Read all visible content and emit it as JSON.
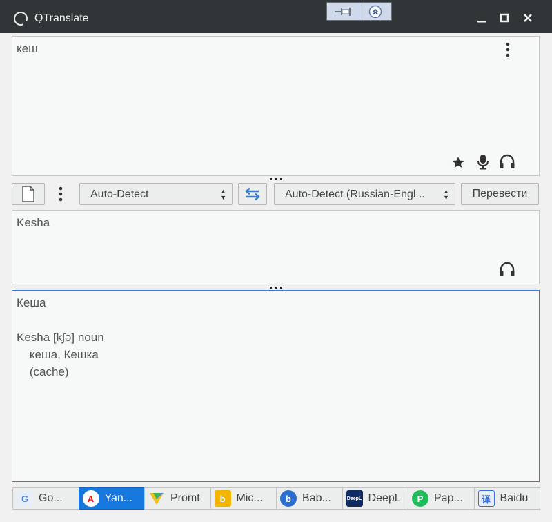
{
  "window": {
    "title": "QTranslate"
  },
  "source": {
    "text": "кеш"
  },
  "toolbar": {
    "source_lang": "Auto-Detect",
    "target_lang": "Auto-Detect (Russian-Engl...",
    "translate_label": "Перевести"
  },
  "translation": {
    "text": "Kesha"
  },
  "dictionary": {
    "text": "Кеша\n\nKesha [kʃə] noun\n    кеша, Кешка\n    (cache)"
  },
  "services": [
    {
      "label": "Go...",
      "icon": "google-icon",
      "color": "#4a7fd6"
    },
    {
      "label": "Yan...",
      "icon": "yandex-icon",
      "color": "#e02020"
    },
    {
      "label": "Promt",
      "icon": "promt-icon",
      "color": "#f0c020"
    },
    {
      "label": "Mic...",
      "icon": "bing-icon",
      "color": "#f5b400"
    },
    {
      "label": "Bab...",
      "icon": "babylon-icon",
      "color": "#2a6fd0"
    },
    {
      "label": "DeepL",
      "icon": "deepl-icon",
      "color": "#0f2b62"
    },
    {
      "label": "Pap...",
      "icon": "papago-icon",
      "color": "#1fbd5a"
    },
    {
      "label": "Baidu",
      "icon": "baidu-icon",
      "color": "#3b6fd8"
    }
  ],
  "active_service": "Yan..."
}
